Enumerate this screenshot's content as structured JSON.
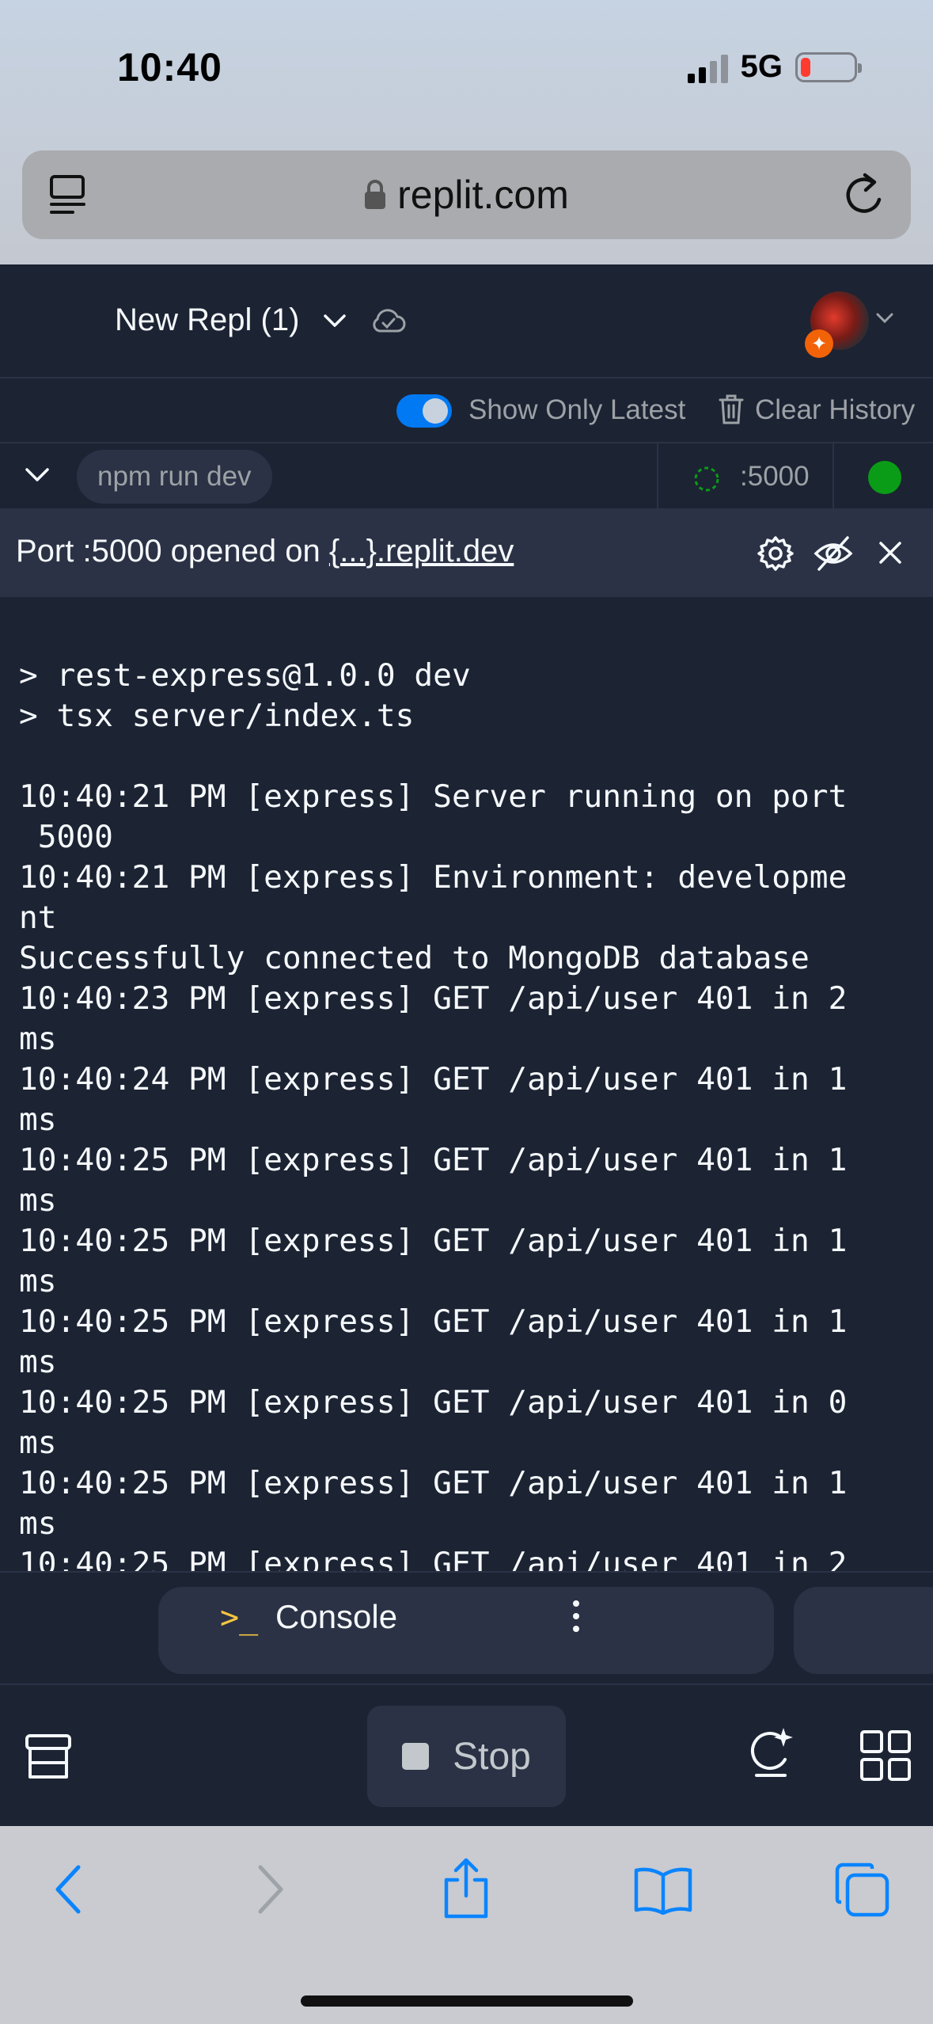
{
  "status_bar": {
    "time": "10:40",
    "network": "5G"
  },
  "browser": {
    "url": "replit.com"
  },
  "header": {
    "repl_name": "New Repl (1)"
  },
  "history": {
    "show_only_latest_label": "Show Only Latest",
    "show_only_latest_enabled": true,
    "clear_history_label": "Clear History"
  },
  "process": {
    "command": "npm run dev",
    "port": ":5000",
    "status_color": "#0a9c17"
  },
  "port_banner": {
    "prefix": "Port :5000 opened on ",
    "link": "{...}.replit.dev"
  },
  "console": {
    "lines": [
      "> rest-express@1.0.0 dev",
      "> tsx server/index.ts",
      "",
      "10:40:21 PM [express] Server running on port",
      " 5000",
      "10:40:21 PM [express] Environment: developme",
      "nt",
      "Successfully connected to MongoDB database",
      "10:40:23 PM [express] GET /api/user 401 in 2",
      "ms",
      "10:40:24 PM [express] GET /api/user 401 in 1",
      "ms",
      "10:40:25 PM [express] GET /api/user 401 in 1",
      "ms",
      "10:40:25 PM [express] GET /api/user 401 in 1",
      "ms",
      "10:40:25 PM [express] GET /api/user 401 in 1",
      "ms",
      "10:40:25 PM [express] GET /api/user 401 in 0",
      "ms",
      "10:40:25 PM [express] GET /api/user 401 in 1",
      "ms",
      "10:40:25 PM [express] GET /api/user 401 in 2"
    ]
  },
  "tabs": {
    "console_icon": ">_",
    "console_label": "Console"
  },
  "actions": {
    "stop_label": "Stop"
  },
  "colors": {
    "background": "#1c2333",
    "surface": "#2b3245",
    "accent": "#0079f2",
    "text": "#f5f9fc",
    "muted": "#9da2a6",
    "ios_blue": "#0a84ff"
  }
}
